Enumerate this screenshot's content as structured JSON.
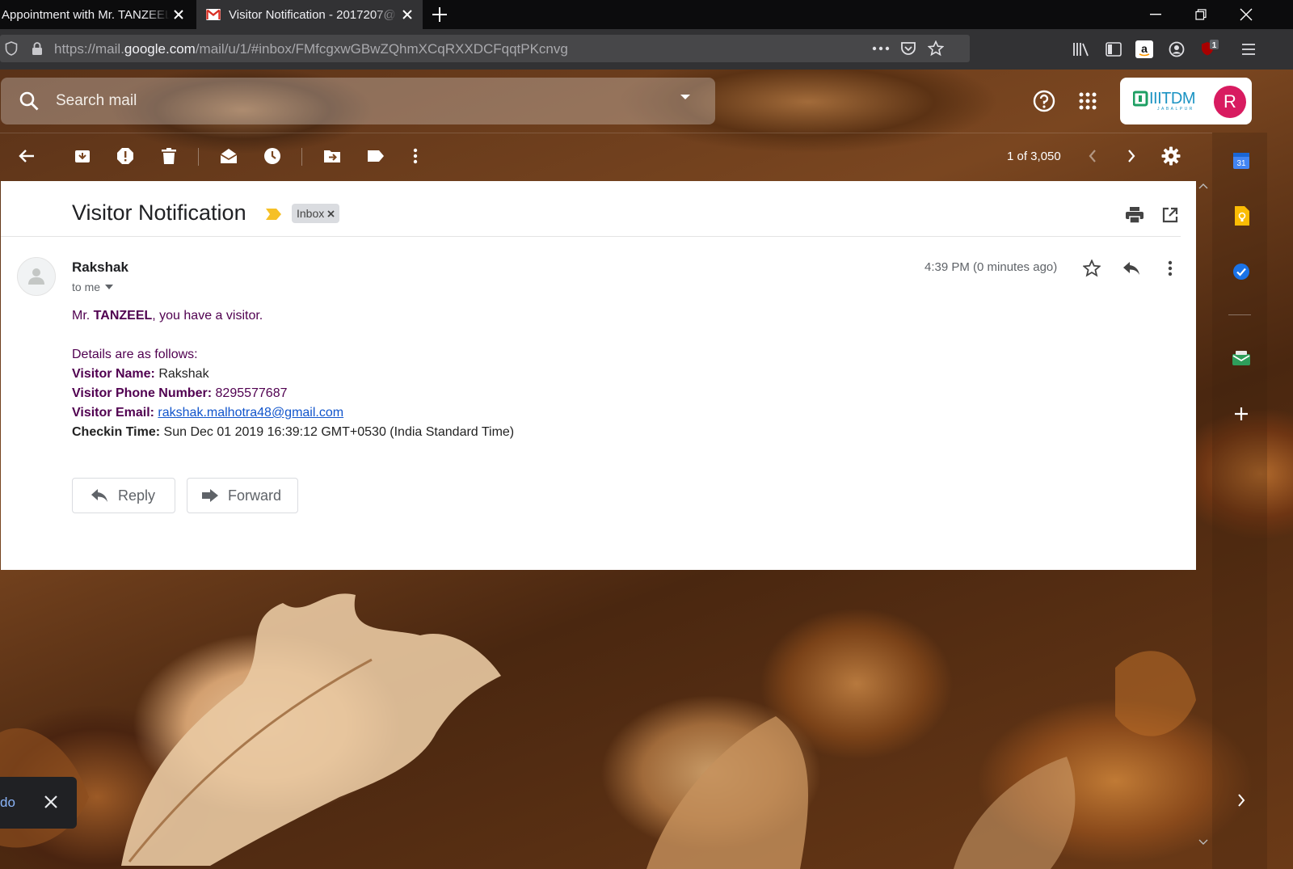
{
  "browser": {
    "tabs": [
      {
        "title": "Appointment with Mr. TANZEEL"
      },
      {
        "title": "Visitor Notification - 2017207@"
      }
    ],
    "url_prefix": "https://mail.",
    "url_host": "google.com",
    "url_path": "/mail/u/1/#inbox/FMfcgxwGBwZQhmXCqRXXDCFqqtPKcnvg",
    "ublock_badge": "1"
  },
  "gmail": {
    "search_placeholder": "Search mail",
    "org_logo_text": "IIITDM",
    "org_logo_subtext": "JABALPUR",
    "avatar_letter": "R",
    "avatar_color": "#d81b60",
    "pager_text": "1 of 3,050"
  },
  "message": {
    "subject": "Visitor Notification",
    "label": "Inbox",
    "sender": "Rakshak",
    "recipient": "to me",
    "timestamp": "4:39 PM (0 minutes ago)",
    "greeting_prefix": "Mr. ",
    "greeting_name": "TANZEEL",
    "greeting_suffix": ", you have a visitor.",
    "details_intro": "Details are as follows:",
    "fields": {
      "name_label": "Visitor Name:",
      "name_value": "Rakshak",
      "phone_label": "Visitor Phone Number:",
      "phone_value": "8295577687",
      "email_label": "Visitor Email:",
      "email_value": "rakshak.malhotra48@gmail.com",
      "checkin_label": "Checkin Time:",
      "checkin_value": "Sun Dec 01 2019 16:39:12 GMT+0530 (India Standard Time)"
    },
    "reply_label": "Reply",
    "forward_label": "Forward"
  },
  "toast": {
    "text": "do"
  }
}
